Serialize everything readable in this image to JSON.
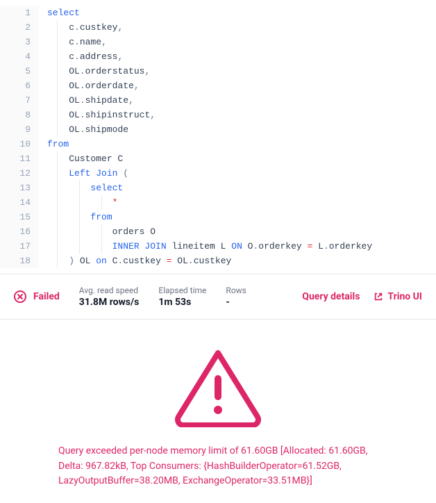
{
  "code": {
    "lines": [
      {
        "num": 1,
        "indent": 0,
        "tokens": [
          {
            "t": "select",
            "c": "kw"
          }
        ]
      },
      {
        "num": 2,
        "indent": 1,
        "tokens": [
          {
            "t": "c",
            "c": "ident"
          },
          {
            "t": ".",
            "c": "punct"
          },
          {
            "t": "custkey",
            "c": "ident"
          },
          {
            "t": ",",
            "c": "punct"
          }
        ]
      },
      {
        "num": 3,
        "indent": 1,
        "tokens": [
          {
            "t": "c",
            "c": "ident"
          },
          {
            "t": ".",
            "c": "punct"
          },
          {
            "t": "name",
            "c": "ident"
          },
          {
            "t": ",",
            "c": "punct"
          }
        ]
      },
      {
        "num": 4,
        "indent": 1,
        "tokens": [
          {
            "t": "c",
            "c": "ident"
          },
          {
            "t": ".",
            "c": "punct"
          },
          {
            "t": "address",
            "c": "ident"
          },
          {
            "t": ",",
            "c": "punct"
          }
        ]
      },
      {
        "num": 5,
        "indent": 1,
        "tokens": [
          {
            "t": "OL",
            "c": "ident"
          },
          {
            "t": ".",
            "c": "punct"
          },
          {
            "t": "orderstatus",
            "c": "ident"
          },
          {
            "t": ",",
            "c": "punct"
          }
        ]
      },
      {
        "num": 6,
        "indent": 1,
        "tokens": [
          {
            "t": "OL",
            "c": "ident"
          },
          {
            "t": ".",
            "c": "punct"
          },
          {
            "t": "orderdate",
            "c": "ident"
          },
          {
            "t": ",",
            "c": "punct"
          }
        ]
      },
      {
        "num": 7,
        "indent": 1,
        "tokens": [
          {
            "t": "OL",
            "c": "ident"
          },
          {
            "t": ".",
            "c": "punct"
          },
          {
            "t": "shipdate",
            "c": "ident"
          },
          {
            "t": ",",
            "c": "punct"
          }
        ]
      },
      {
        "num": 8,
        "indent": 1,
        "tokens": [
          {
            "t": "OL",
            "c": "ident"
          },
          {
            "t": ".",
            "c": "punct"
          },
          {
            "t": "shipinstruct",
            "c": "ident"
          },
          {
            "t": ",",
            "c": "punct"
          }
        ]
      },
      {
        "num": 9,
        "indent": 1,
        "tokens": [
          {
            "t": "OL",
            "c": "ident"
          },
          {
            "t": ".",
            "c": "punct"
          },
          {
            "t": "shipmode",
            "c": "ident"
          }
        ]
      },
      {
        "num": 10,
        "indent": 0,
        "tokens": [
          {
            "t": "from",
            "c": "kw"
          }
        ]
      },
      {
        "num": 11,
        "indent": 1,
        "tokens": [
          {
            "t": "Customer C",
            "c": "ident"
          }
        ]
      },
      {
        "num": 12,
        "indent": 1,
        "tokens": [
          {
            "t": "Left Join",
            "c": "kw"
          },
          {
            "t": " (",
            "c": "punct"
          }
        ]
      },
      {
        "num": 13,
        "indent": 2,
        "tokens": [
          {
            "t": "select",
            "c": "kw"
          }
        ]
      },
      {
        "num": 14,
        "indent": 3,
        "tokens": [
          {
            "t": "*",
            "c": "op"
          }
        ]
      },
      {
        "num": 15,
        "indent": 2,
        "tokens": [
          {
            "t": "from",
            "c": "kw"
          }
        ]
      },
      {
        "num": 16,
        "indent": 3,
        "tokens": [
          {
            "t": "orders O",
            "c": "ident"
          }
        ]
      },
      {
        "num": 17,
        "indent": 3,
        "tokens": [
          {
            "t": "INNER JOIN",
            "c": "kw"
          },
          {
            "t": " lineitem L ",
            "c": "ident"
          },
          {
            "t": "ON",
            "c": "kw"
          },
          {
            "t": " O",
            "c": "ident"
          },
          {
            "t": ".",
            "c": "punct"
          },
          {
            "t": "orderkey ",
            "c": "ident"
          },
          {
            "t": "=",
            "c": "op"
          },
          {
            "t": " L",
            "c": "ident"
          },
          {
            "t": ".",
            "c": "punct"
          },
          {
            "t": "orderkey",
            "c": "ident"
          }
        ]
      },
      {
        "num": 18,
        "indent": 1,
        "tokens": [
          {
            "t": ") ",
            "c": "punct"
          },
          {
            "t": "OL ",
            "c": "ident"
          },
          {
            "t": "on",
            "c": "kw"
          },
          {
            "t": " C",
            "c": "ident"
          },
          {
            "t": ".",
            "c": "punct"
          },
          {
            "t": "custkey ",
            "c": "ident"
          },
          {
            "t": "=",
            "c": "op"
          },
          {
            "t": " OL",
            "c": "ident"
          },
          {
            "t": ".",
            "c": "punct"
          },
          {
            "t": "custkey",
            "c": "ident"
          }
        ]
      }
    ]
  },
  "status": {
    "state": "Failed",
    "stats": [
      {
        "label": "Avg. read speed",
        "value": "31.8M rows/s"
      },
      {
        "label": "Elapsed time",
        "value": "1m 53s"
      },
      {
        "label": "Rows",
        "value": "-"
      }
    ],
    "links": {
      "query_details": "Query details",
      "trino_ui": "Trino UI"
    }
  },
  "error": {
    "message": "Query exceeded per-node memory limit of 61.60GB [Allocated: 61.60GB, Delta: 967.82kB, Top Consumers: {HashBuilderOperator=61.52GB, LazyOutputBuffer=38.20MB, ExchangeOperator=33.51MB}]"
  },
  "colors": {
    "accent": "#dc2668",
    "keyword": "#2563eb"
  }
}
